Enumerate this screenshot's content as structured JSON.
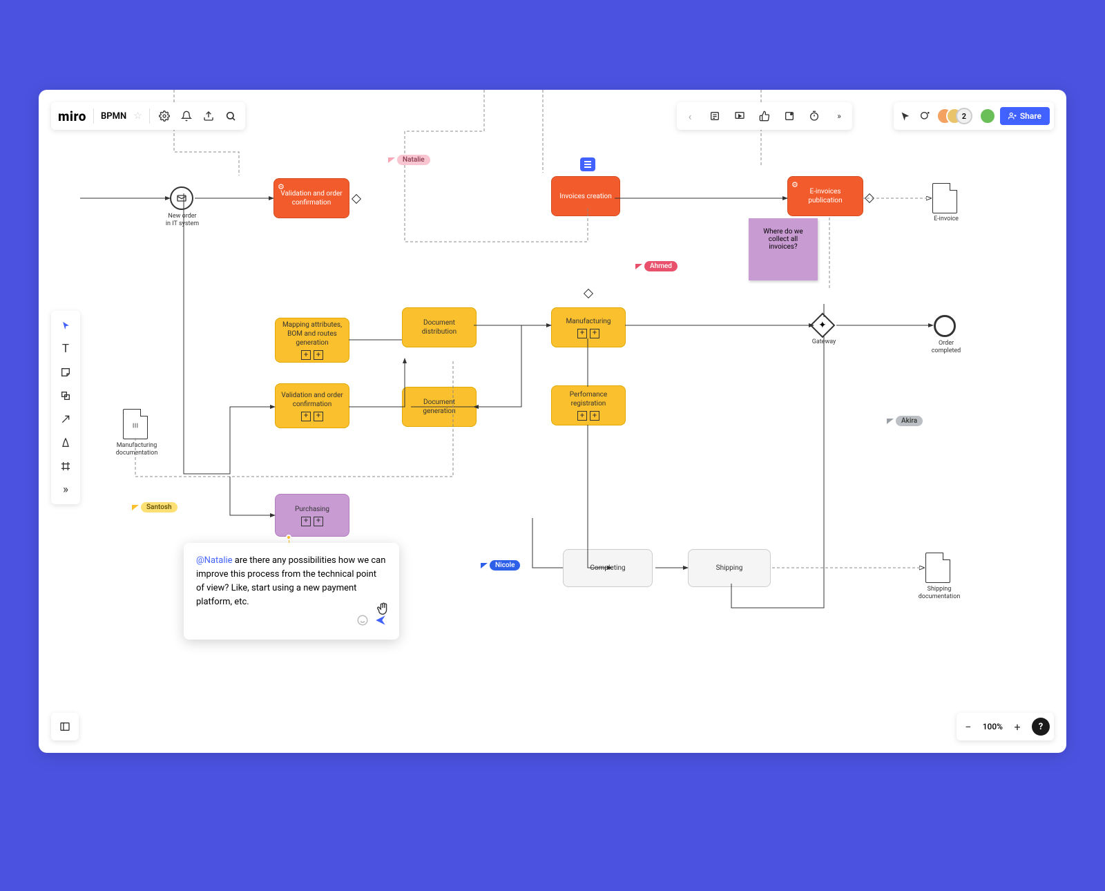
{
  "app": {
    "logo": "miro",
    "board": "BPMN"
  },
  "toolbar_top": {
    "share": "Share"
  },
  "zoom": {
    "level": "100%"
  },
  "presence_count": "2",
  "cursors": {
    "natalie": "Natalie",
    "ahmed": "Ahmed",
    "santosh": "Santosh",
    "nicole": "Nicole",
    "akira": "Akira"
  },
  "nodes": {
    "new_order": "New order\nin IT system",
    "validation_order": "Validation and order confirmation",
    "invoices_creation": "Invoices creation",
    "einvoice_pub": "E-invoices publication",
    "einvoice_doc": "E-invoice",
    "mapping": "Mapping attributes, BOM and routes generation",
    "doc_distribution": "Document distribution",
    "doc_generation": "Document generation",
    "manufacturing": "Manufacturing",
    "validation2": "Validation and order confirmation",
    "performance": "Perfomance registration",
    "mfg_doc": "Manufacturing\ndocumentation",
    "gateway": "Gateway",
    "order_completed": "Order\ncompleted",
    "purchasing": "Purchasing",
    "completing": "Completing",
    "shipping": "Shipping",
    "shipping_doc": "Shipping\ndocumentation"
  },
  "sticky": "Where do we collect all invoices?",
  "comment": {
    "mention": "@Natalie",
    "body": " are there any possibilities how we can improve this process from the technical point of view? Like, start using a new payment platform, etc."
  }
}
